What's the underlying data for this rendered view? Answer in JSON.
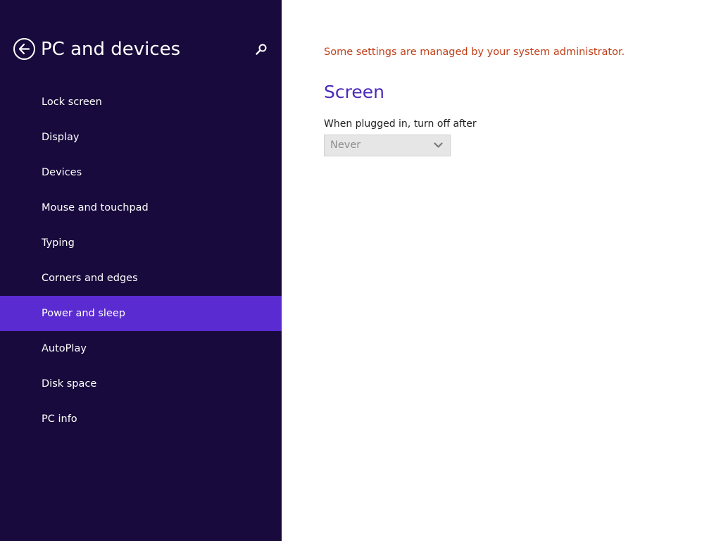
{
  "nav": {
    "title": "PC and devices",
    "back_icon": "back-arrow-icon",
    "search_icon": "search-icon",
    "selected_index": 6,
    "items": [
      {
        "label": "Lock screen"
      },
      {
        "label": "Display"
      },
      {
        "label": "Devices"
      },
      {
        "label": "Mouse and touchpad"
      },
      {
        "label": "Typing"
      },
      {
        "label": "Corners and edges"
      },
      {
        "label": "Power and sleep"
      },
      {
        "label": "AutoPlay"
      },
      {
        "label": "Disk space"
      },
      {
        "label": "PC info"
      }
    ]
  },
  "content": {
    "admin_notice": "Some settings are managed by your system administrator.",
    "section_heading": "Screen",
    "setting_label": "When plugged in, turn off after",
    "setting_value": "Never",
    "setting_disabled": true,
    "dropdown_icon": "chevron-down-icon"
  },
  "colors": {
    "nav_background": "#180a3c",
    "nav_selected": "#5a2bd0",
    "heading": "#4b2bb8",
    "notice": "#c0401a"
  }
}
